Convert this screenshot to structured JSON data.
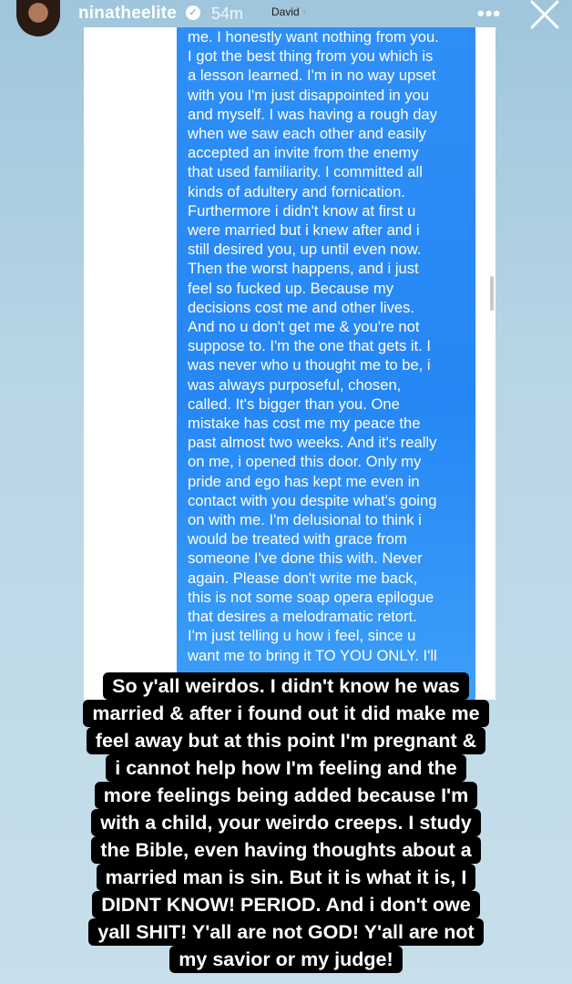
{
  "header": {
    "username": "ninatheelite",
    "time": "54m",
    "contact": "David",
    "more_icon": "more-options-icon",
    "close_icon": "close-icon"
  },
  "message": {
    "text": "me. I honestly want nothing from you.\nI got the best thing from you which is\na lesson learned. I'm in no way upset\nwith you I'm just disappointed in you\nand myself. I was having a rough day\nwhen we saw each other and easily\naccepted an invite from the enemy\nthat used familiarity. I committed all\nkinds of adultery and fornication.\nFurthermore i didn't know at first u\nwere married but i knew after and i\nstill desired you, up until even now.\nThen the worst happens, and i just\nfeel so fucked up. Because my\ndecisions cost me and other lives.\nAnd no u don't get me & you're not\nsuppose to. I'm the one that gets it. I\nwas never who u thought me to be, i\nwas always purposeful, chosen,\ncalled. It's bigger than you. One\nmistake has cost me my peace the\npast almost two weeks. And it's really\non me, i opened this door. Only my\npride and ego has kept me even in\ncontact with you despite what's going\non with me. I'm delusional to think i\nwould be treated with grace from\nsomeone I've done this with. Never\nagain. Please don't write me back,\nthis is not some soap opera epilogue\nthat desires a melodramatic retort.\nI'm just telling u how i feel, since u\nwant me to bring it TO YOU ONLY. I'll"
  },
  "caption": {
    "lines": [
      "So y'all weirdos. I didn't know he was",
      "married & after i found out it did make me",
      "feel away but at this point I'm pregnant &",
      "i cannot help how I'm feeling and the",
      "more feelings being added because I'm",
      "with a child, your weirdo creeps. I study",
      "the Bible, even having thoughts about a",
      "married man is sin. But it is what it is, I",
      "DIDNT KNOW! PERIOD. And i don't owe",
      "yall SHIT! Y'all are not GOD! Y'all are not",
      "my savior or my judge!"
    ]
  },
  "colors": {
    "bubble": "#2587f5",
    "background": "#b9d6e6",
    "caption_bg": "#000000"
  }
}
